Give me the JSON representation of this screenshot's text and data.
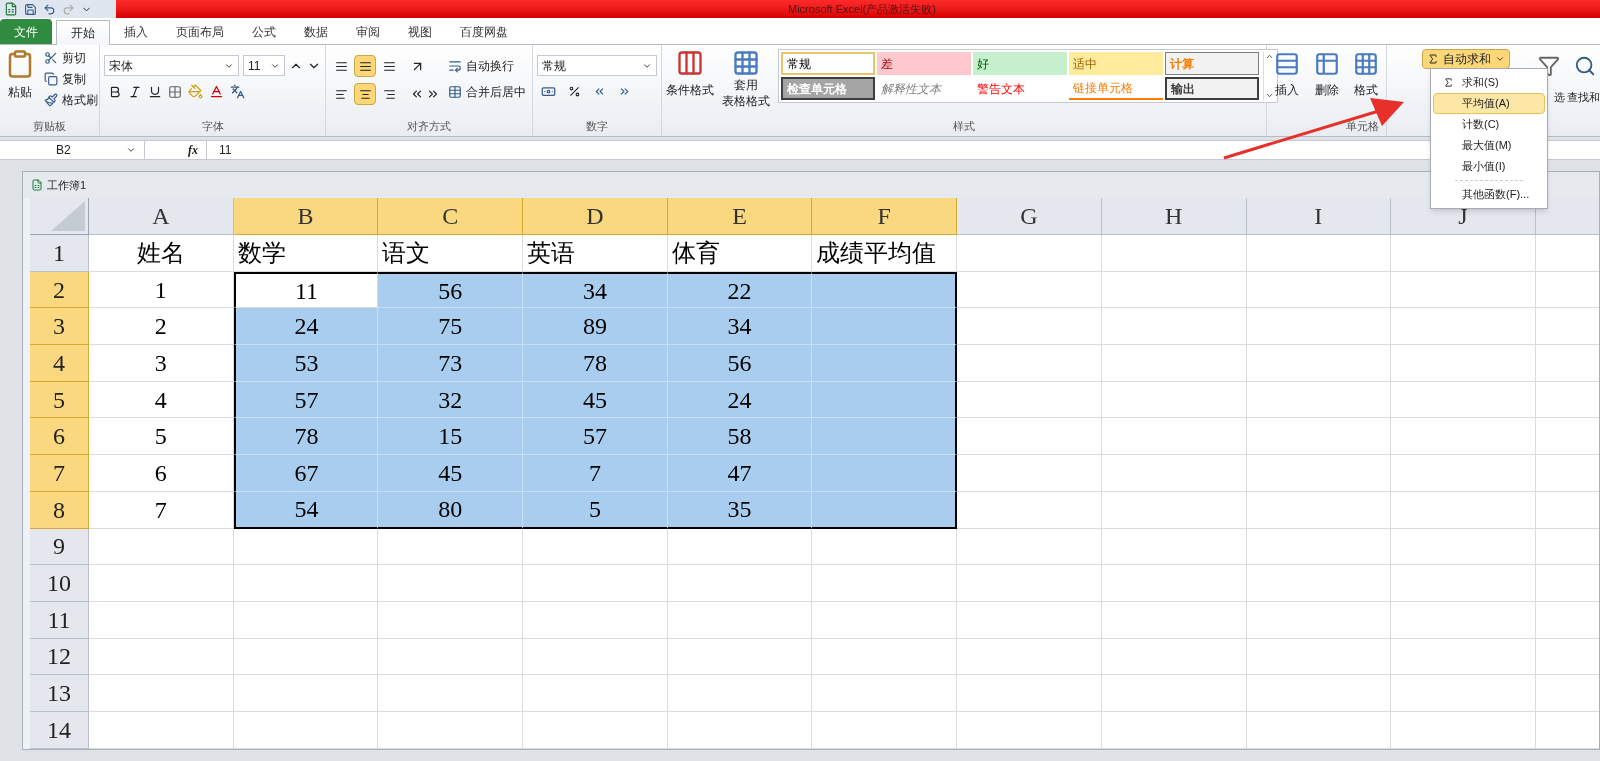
{
  "window": {
    "title": "Microsoft Excel(产品激活失败)"
  },
  "tabs": [
    {
      "label": "文件",
      "kind": "file",
      "selected": false
    },
    {
      "label": "开始",
      "kind": "tab",
      "selected": true
    },
    {
      "label": "插入",
      "kind": "tab",
      "selected": false
    },
    {
      "label": "页面布局",
      "kind": "tab",
      "selected": false
    },
    {
      "label": "公式",
      "kind": "tab",
      "selected": false
    },
    {
      "label": "数据",
      "kind": "tab",
      "selected": false
    },
    {
      "label": "审阅",
      "kind": "tab",
      "selected": false
    },
    {
      "label": "视图",
      "kind": "tab",
      "selected": false
    },
    {
      "label": "百度网盘",
      "kind": "tab",
      "selected": false
    }
  ],
  "ribbon": {
    "clipboard": {
      "label": "剪贴板",
      "paste": "粘贴",
      "items": [
        "剪切",
        "复制",
        "格式刷"
      ]
    },
    "font": {
      "label": "字体",
      "font_name": "宋体",
      "font_size": "11"
    },
    "alignment": {
      "label": "对齐方式",
      "wrap": "自动换行",
      "merge": "合并后居中",
      "vertical_align": [
        {
          "selected": false
        },
        {
          "selected": true
        },
        {
          "selected": false
        }
      ],
      "horizontal_align": [
        {
          "selected": false
        },
        {
          "selected": true
        },
        {
          "selected": false
        }
      ]
    },
    "number": {
      "label": "数字",
      "format": "常规"
    },
    "styles": {
      "label": "样式",
      "conditional": "条件格式",
      "table_format": [
        "套用",
        "表格格式"
      ],
      "gallery": [
        {
          "label": "常规",
          "kind": "normal"
        },
        {
          "label": "差",
          "kind": "bad"
        },
        {
          "label": "好",
          "kind": "good"
        },
        {
          "label": "适中",
          "kind": "neutral"
        },
        {
          "label": "计算",
          "kind": "calculation"
        },
        {
          "label": "检查单元格",
          "kind": "check"
        },
        {
          "label": "解释性文本",
          "kind": "explanatory"
        },
        {
          "label": "警告文本",
          "kind": "warning"
        },
        {
          "label": "链接单元格",
          "kind": "linked"
        },
        {
          "label": "输出",
          "kind": "output"
        }
      ]
    },
    "cells": {
      "label": "单元格",
      "buttons": [
        "插入",
        "删除",
        "格式"
      ]
    },
    "editing": {
      "autosum": "自动求和",
      "autosum_open": true,
      "sort_filter": "选",
      "find": "查找和"
    }
  },
  "autosum_menu": [
    {
      "label": "求和(S)",
      "kind": "sum",
      "selected": false
    },
    {
      "label": "平均值(A)",
      "kind": "item",
      "selected": true
    },
    {
      "label": "计数(C)",
      "kind": "item",
      "selected": false
    },
    {
      "label": "最大值(M)",
      "kind": "item",
      "selected": false
    },
    {
      "label": "最小值(I)",
      "kind": "item",
      "selected": false
    },
    {
      "label": "其他函数(F)...",
      "kind": "more",
      "selected": false
    }
  ],
  "formula_bar": {
    "name_box": "B2",
    "fx": "fx",
    "value": "11"
  },
  "workbook": {
    "title": "工作簿1"
  },
  "sheet": {
    "columns": [
      {
        "label": "A",
        "selected": false
      },
      {
        "label": "B",
        "selected": true
      },
      {
        "label": "C",
        "selected": true
      },
      {
        "label": "D",
        "selected": true
      },
      {
        "label": "E",
        "selected": true
      },
      {
        "label": "F",
        "selected": true
      },
      {
        "label": "G",
        "selected": false
      },
      {
        "label": "H",
        "selected": false
      },
      {
        "label": "I",
        "selected": false
      },
      {
        "label": "J",
        "selected": false
      }
    ],
    "rows": [
      {
        "label": "1",
        "kind": "heading",
        "selected": false,
        "cells": [
          "姓名",
          "数学",
          "语文",
          "英语",
          "体育",
          "成绩平均值"
        ]
      },
      {
        "label": "2",
        "kind": "data",
        "selected": true,
        "cells": [
          "1",
          "11",
          "56",
          "34",
          "22"
        ]
      },
      {
        "label": "3",
        "kind": "data",
        "selected": true,
        "cells": [
          "2",
          "24",
          "75",
          "89",
          "34"
        ]
      },
      {
        "label": "4",
        "kind": "data",
        "selected": true,
        "cells": [
          "3",
          "53",
          "73",
          "78",
          "56"
        ]
      },
      {
        "label": "5",
        "kind": "data",
        "selected": true,
        "cells": [
          "4",
          "57",
          "32",
          "45",
          "24"
        ]
      },
      {
        "label": "6",
        "kind": "data",
        "selected": true,
        "cells": [
          "5",
          "78",
          "15",
          "57",
          "58"
        ]
      },
      {
        "label": "7",
        "kind": "data",
        "selected": true,
        "cells": [
          "6",
          "67",
          "45",
          "7",
          "47"
        ]
      },
      {
        "label": "8",
        "kind": "data",
        "selected": true,
        "cells": [
          "7",
          "54",
          "80",
          "5",
          "35"
        ]
      },
      {
        "label": "9",
        "kind": "data",
        "selected": false,
        "cells": []
      },
      {
        "label": "10",
        "kind": "data",
        "selected": false,
        "cells": []
      },
      {
        "label": "11",
        "kind": "data",
        "selected": false,
        "cells": []
      },
      {
        "label": "12",
        "kind": "data",
        "selected": false,
        "cells": []
      },
      {
        "label": "13",
        "kind": "data",
        "selected": false,
        "cells": []
      },
      {
        "label": "14",
        "kind": "data",
        "selected": false,
        "cells": []
      }
    ]
  }
}
